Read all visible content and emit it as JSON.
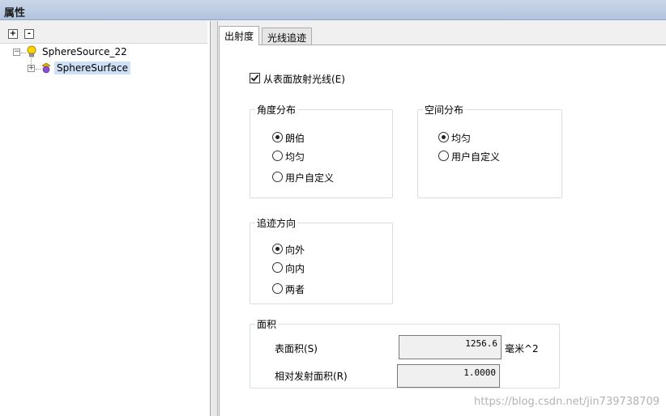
{
  "titlebar": {
    "title": "属性"
  },
  "tree": {
    "expand_all_label": "+",
    "collapse_all_label": "-",
    "root": {
      "label": "SphereSource_22",
      "expander": "−",
      "icon": "lightbulb-icon"
    },
    "child": {
      "label": "SphereSurface",
      "expander": "+",
      "icon": "sphere-surface-icon"
    }
  },
  "tabs": [
    {
      "label": "出射度",
      "active": true
    },
    {
      "label": "光线追迹",
      "active": false
    }
  ],
  "emit_from_surface": {
    "label": "从表面放射光线(E)",
    "checked": true
  },
  "angular_distribution": {
    "title": "角度分布",
    "options": [
      "朗伯",
      "均匀",
      "用户自定义"
    ],
    "selected": "朗伯"
  },
  "spatial_distribution": {
    "title": "空间分布",
    "options": [
      "均匀",
      "用户自定义"
    ],
    "selected": "均匀"
  },
  "trace_direction": {
    "title": "追迹方向",
    "options": [
      "向外",
      "向内",
      "两者"
    ],
    "selected": "向外"
  },
  "area": {
    "title": "面积",
    "surface_area_label": "表面积(S)",
    "surface_area_value": "1256.6",
    "surface_area_unit": "毫米^2",
    "relative_area_label": "相对发射面积(R)",
    "relative_area_value": "1.0000"
  },
  "watermark": "https://blog.csdn.net/jin739738709"
}
